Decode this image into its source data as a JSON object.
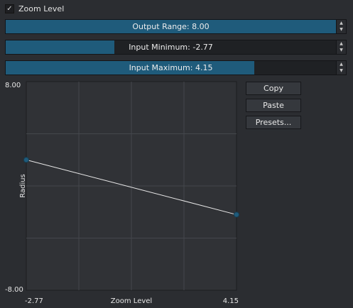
{
  "zoom_checkbox": {
    "checked_glyph": "✓",
    "label": "Zoom Level",
    "checked": true
  },
  "fields": {
    "output_range": {
      "label": "Output Range: 8.00",
      "fill_fraction": 1.0
    },
    "input_minimum": {
      "label": "Input Minimum: -2.77",
      "fill_fraction": 0.32
    },
    "input_maximum": {
      "label": "Input Maximum: 4.15",
      "fill_fraction": 0.73
    },
    "spin_up_glyph": "▲",
    "spin_down_glyph": "▼"
  },
  "buttons": {
    "copy": "Copy",
    "paste": "Paste",
    "presets": "Presets..."
  },
  "chart_data": {
    "type": "line",
    "xlabel": "Zoom Level",
    "ylabel": "Radius",
    "xlim": [
      -2.77,
      4.15
    ],
    "ylim": [
      -8.0,
      8.0
    ],
    "x_tick_labels": [
      "-2.77",
      "4.15"
    ],
    "y_tick_labels": [
      "8.00",
      "-8.00"
    ],
    "grid": true,
    "points": [
      {
        "x": -2.77,
        "y": 2.0
      },
      {
        "x": 4.15,
        "y": -2.2
      }
    ]
  },
  "colors": {
    "accent": "#1f5b7b",
    "background": "#2b2d31",
    "plot_background": "#303236",
    "line": "#e8e8e8",
    "point": "#1f5b7b"
  }
}
